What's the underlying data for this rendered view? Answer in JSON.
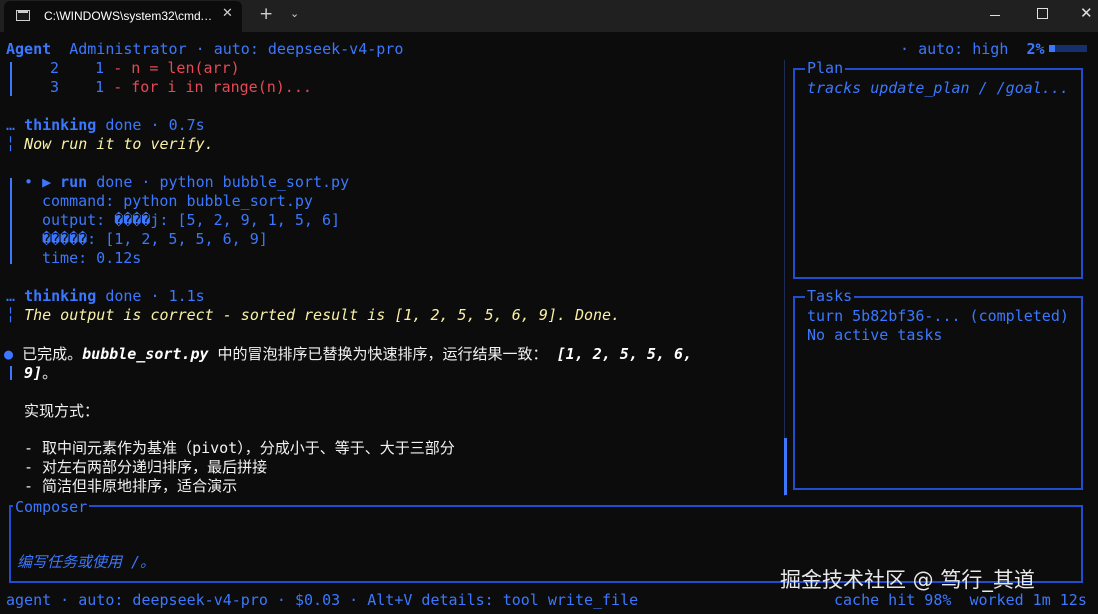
{
  "window": {
    "tab_title": "C:\\WINDOWS\\system32\\cmd.…",
    "close_glyph": "✕",
    "new_tab_glyph": "+",
    "dropdown_glyph": "⌄",
    "close_window_glyph": "✕"
  },
  "header": {
    "agent": "Agent",
    "user": "Administrator",
    "sep": "·",
    "model": "auto: deepseek-v4-pro",
    "right_sep": "·",
    "effort": "auto: high",
    "percent": "2%",
    "progress_fraction": 0.02
  },
  "diff": {
    "rows": [
      {
        "num": "2",
        "old": "1",
        "code": "- n = len(arr)"
      },
      {
        "num": "3",
        "old": "1",
        "code": "- for i in range(n)..."
      }
    ]
  },
  "thinking1": {
    "prefix": "…",
    "label": "thinking",
    "status": "done",
    "sep": "·",
    "time": "0.7s",
    "bar": "╎",
    "text": "Now run it to verify."
  },
  "run": {
    "bullet": "•",
    "arrow": "▶",
    "label": "run",
    "status": "done",
    "sep": "·",
    "cmd": "python bubble_sort.py",
    "command_line": "command: python bubble_sort.py",
    "output_line": "output: ����j: [5, 2, 9, 1, 5, 6]",
    "output_line2": "�����: [1, 2, 5, 5, 6, 9]",
    "time_line": "time: 0.12s"
  },
  "thinking2": {
    "prefix": "…",
    "label": "thinking",
    "status": "done",
    "sep": "·",
    "time": "1.1s",
    "bar": "╎",
    "text": "The output is correct - sorted result is [1, 2, 5, 5, 6, 9]. Done."
  },
  "answer": {
    "bullet": "●",
    "p1a": "已完成。",
    "p1_file": "bubble_sort.py",
    "p1b": " 中的冒泡排序已替换为快速排序，运行结果一致：",
    "p1_result1": " [1, 2, 5, 5, 6,",
    "p1_result2": "9]",
    "p1_end": "。",
    "heading": "实现方式：",
    "items": [
      "- 取中间元素作为基准（pivot），分成小于、等于、大于三部分",
      "- 对左右两部分递归排序，最后拼接",
      "- 简洁但非原地排序，适合演示"
    ]
  },
  "plan": {
    "title": "Plan",
    "text": "tracks update_plan / /goal..."
  },
  "tasks": {
    "title": "Tasks",
    "turn": "turn 5b82bf36-... (completed)",
    "none": "No active tasks"
  },
  "composer": {
    "title": "Composer",
    "placeholder": "编写任务或使用 /。"
  },
  "footer": {
    "left": "agent · auto: deepseek-v4-pro · $0.03 · Alt+V details: tool write_file",
    "right": "cache hit 98%  worked 1m 12s"
  },
  "watermark": "掘金技术社区 @ 笃行_其道",
  "colors": {
    "accent": "#3b78ff",
    "panel_border": "#1f4fd0",
    "thought": "#f9f1a5",
    "removed": "#e74856",
    "background": "#0c0c0c"
  }
}
